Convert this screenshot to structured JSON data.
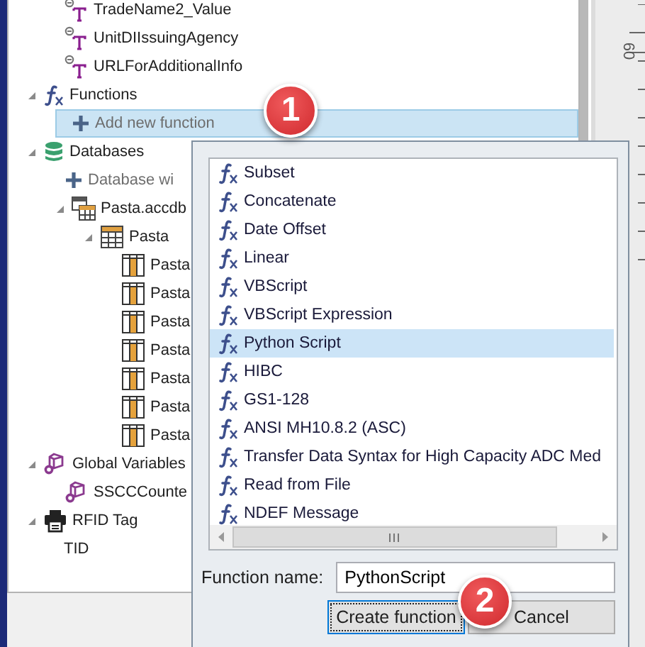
{
  "tree": {
    "continued_items": [
      {
        "label": "TradeName2_Value",
        "kind": "text-field",
        "selected": false
      },
      {
        "label": "UnitDIIssuingAgency",
        "kind": "text-field",
        "selected": false
      },
      {
        "label": "URLForAdditionalInfo",
        "kind": "text-field",
        "selected": false
      }
    ],
    "nodes": [
      {
        "label": "Functions",
        "kind": "function",
        "expanded": true,
        "selected": false,
        "children": [
          {
            "label": "Add new function",
            "kind": "add",
            "selected": true
          }
        ]
      },
      {
        "label": "Databases",
        "kind": "database",
        "expanded": true,
        "selected": false,
        "children": [
          {
            "label": "Database wi",
            "kind": "add",
            "selected": false
          },
          {
            "label": "Pasta.accdb",
            "kind": "db-file",
            "expanded": true,
            "selected": false,
            "children": [
              {
                "label": "Pasta",
                "kind": "table",
                "expanded": true,
                "selected": false,
                "children": [
                  {
                    "label": "Pasta",
                    "kind": "column",
                    "selected": false
                  },
                  {
                    "label": "Pasta",
                    "kind": "column",
                    "selected": false
                  },
                  {
                    "label": "Pasta",
                    "kind": "column",
                    "selected": false
                  },
                  {
                    "label": "Pasta",
                    "kind": "column",
                    "selected": false
                  },
                  {
                    "label": "Pasta",
                    "kind": "column",
                    "selected": false
                  },
                  {
                    "label": "Pasta",
                    "kind": "column",
                    "selected": false
                  },
                  {
                    "label": "Pasta",
                    "kind": "column",
                    "selected": false
                  }
                ]
              }
            ]
          }
        ]
      },
      {
        "label": "Global Variables",
        "kind": "variables",
        "expanded": true,
        "selected": false,
        "children": [
          {
            "label": "SSCCCounte",
            "kind": "variable",
            "selected": false
          }
        ]
      },
      {
        "label": "RFID Tag",
        "kind": "printer",
        "expanded": true,
        "selected": false,
        "children": [
          {
            "label": "TID",
            "kind": "plain",
            "selected": false
          }
        ]
      }
    ]
  },
  "ruler": {
    "label": "60"
  },
  "function_dialog": {
    "functions": [
      {
        "label": "Subset",
        "selected": false
      },
      {
        "label": "Concatenate",
        "selected": false
      },
      {
        "label": "Date Offset",
        "selected": false
      },
      {
        "label": "Linear",
        "selected": false
      },
      {
        "label": "VBScript",
        "selected": false
      },
      {
        "label": "VBScript Expression",
        "selected": false
      },
      {
        "label": "Python Script",
        "selected": true
      },
      {
        "label": "HIBC",
        "selected": false
      },
      {
        "label": "GS1-128",
        "selected": false
      },
      {
        "label": "ANSI MH10.8.2 (ASC)",
        "selected": false
      },
      {
        "label": "Transfer Data Syntax for High Capacity ADC Med",
        "selected": false
      },
      {
        "label": "Read from File",
        "selected": false
      },
      {
        "label": "NDEF Message",
        "selected": false
      }
    ],
    "name_label": "Function name:",
    "name_value": "PythonScript",
    "buttons": [
      {
        "label": "Create function",
        "focused": true
      },
      {
        "label": "Cancel",
        "focused": false
      }
    ]
  },
  "callouts": [
    {
      "number": "1"
    },
    {
      "number": "2"
    }
  ]
}
